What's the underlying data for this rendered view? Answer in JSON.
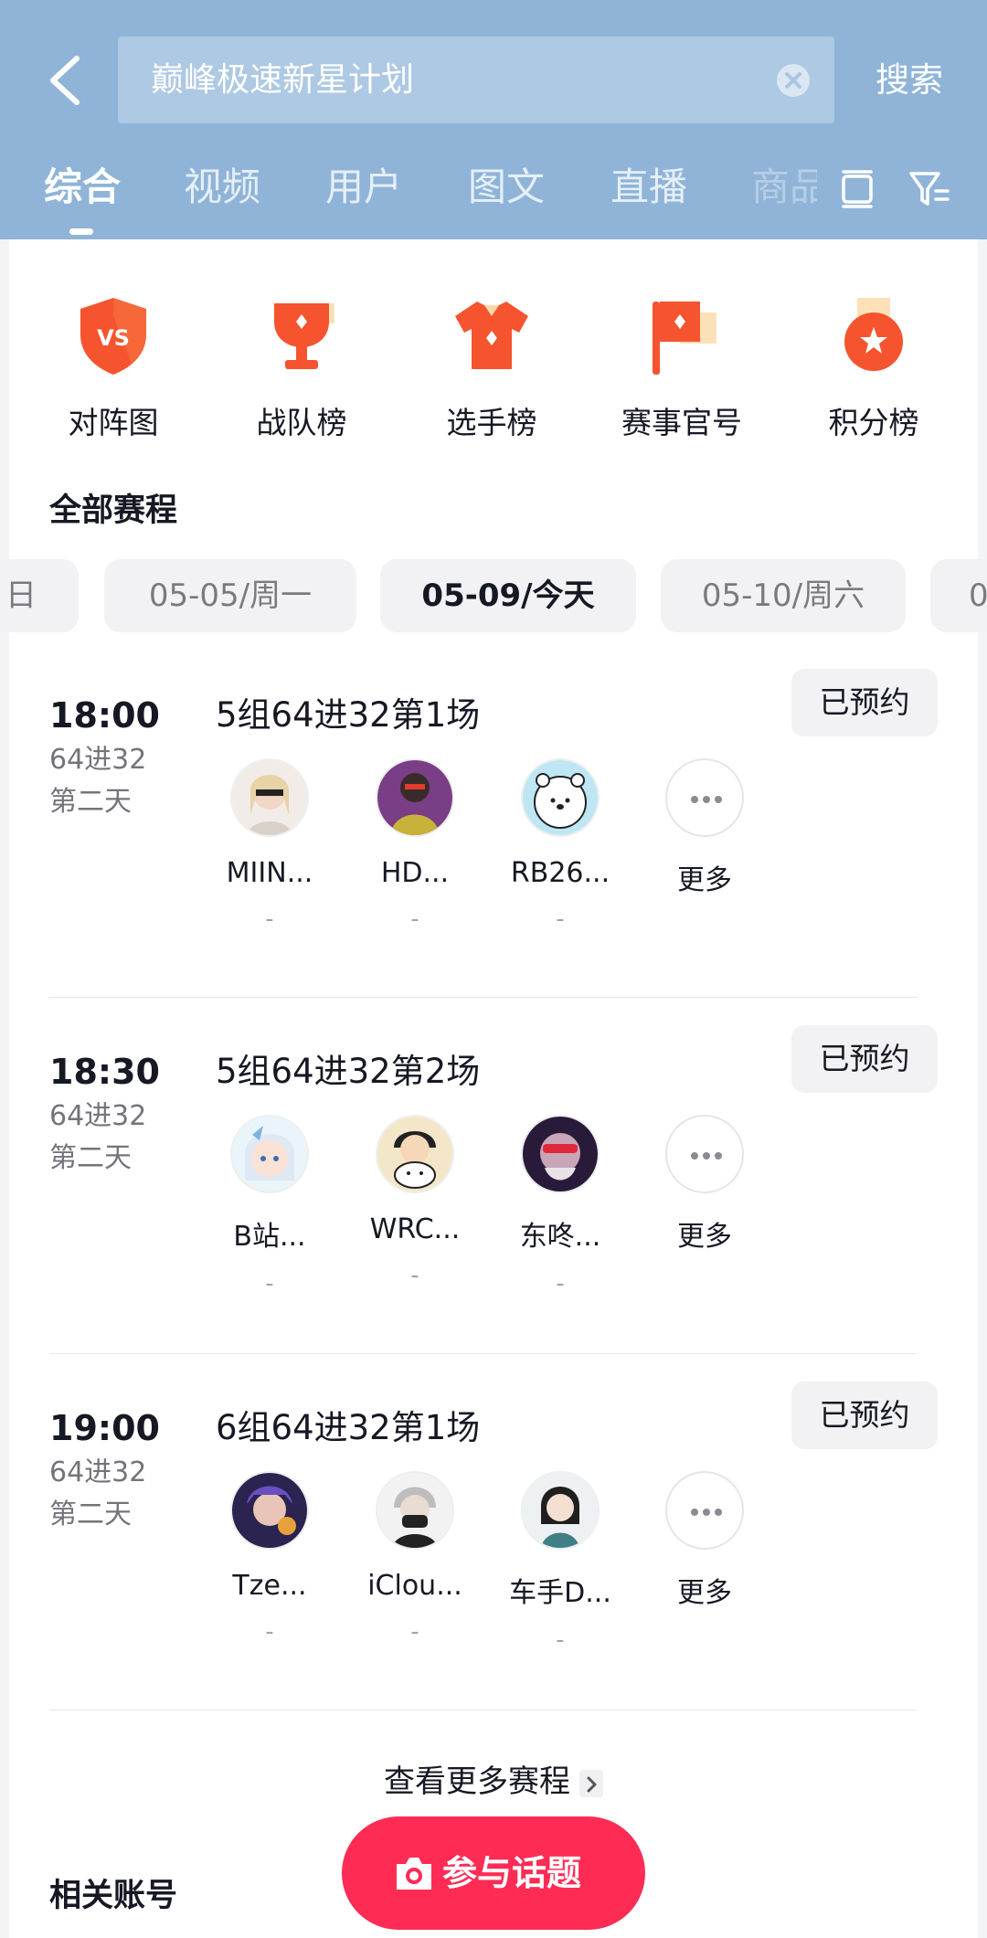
{
  "header": {
    "search_text": "巅峰极速新星计划",
    "search_button": "搜索",
    "tabs": [
      "综合",
      "视频",
      "用户",
      "图文",
      "直播",
      "商品"
    ]
  },
  "quick_entries": [
    {
      "label": "对阵图",
      "icon": "vs-shield-icon"
    },
    {
      "label": "战队榜",
      "icon": "trophy-icon"
    },
    {
      "label": "选手榜",
      "icon": "jersey-icon"
    },
    {
      "label": "赛事官号",
      "icon": "flag-icon"
    },
    {
      "label": "积分榜",
      "icon": "medal-icon"
    }
  ],
  "schedule": {
    "title": "全部赛程",
    "dates": [
      "日",
      "05-05/周一",
      "05-09/今天",
      "05-10/周六",
      "0"
    ],
    "active_date": "05-09/今天"
  },
  "matches": [
    {
      "time": "18:00",
      "round": "64进32",
      "day": "第二天",
      "title": "5组64进32第1场",
      "button": "已预约",
      "players": [
        {
          "name": "MIIN...",
          "score": "-"
        },
        {
          "name": "HD...",
          "score": "-"
        },
        {
          "name": "RB26...",
          "score": "-"
        }
      ],
      "more": "更多"
    },
    {
      "time": "18:30",
      "round": "64进32",
      "day": "第二天",
      "title": "5组64进32第2场",
      "button": "已预约",
      "players": [
        {
          "name": "B站...",
          "score": "-"
        },
        {
          "name": "WRC...",
          "score": "-"
        },
        {
          "name": "东咚...",
          "score": "-"
        }
      ],
      "more": "更多"
    },
    {
      "time": "19:00",
      "round": "64进32",
      "day": "第二天",
      "title": "6组64进32第1场",
      "button": "已预约",
      "players": [
        {
          "name": "Tze...",
          "score": "-"
        },
        {
          "name": "iClou...",
          "score": "-"
        },
        {
          "name": "车手D...",
          "score": "-"
        }
      ],
      "more": "更多"
    }
  ],
  "more_schedule": "查看更多赛程",
  "related_accounts": "相关账号",
  "join_button": "参与话题",
  "colors": {
    "header_bg": "#8fb4d8",
    "accent": "#fe2c55",
    "icon_orange": "#f5542e"
  }
}
